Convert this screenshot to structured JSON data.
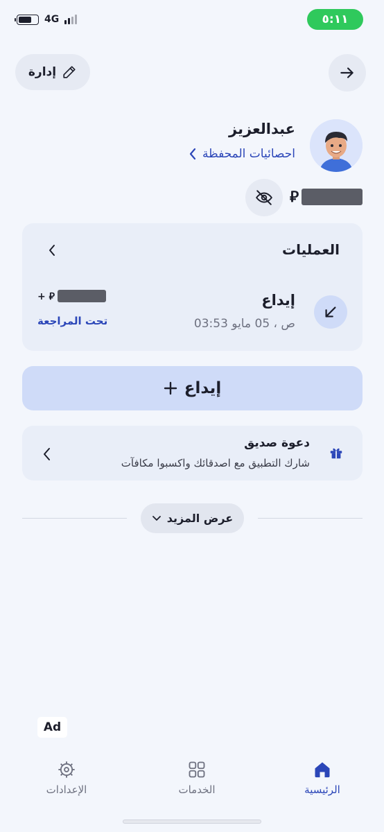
{
  "status_bar": {
    "time": "٥:١١",
    "network": "4G"
  },
  "header": {
    "manage_label": "إدارة"
  },
  "profile": {
    "name": "عبدالعزيز",
    "stats_link": "احصائيات المحفظة"
  },
  "balance": {
    "currency_symbol": "⃁"
  },
  "operations": {
    "title": "العمليات",
    "transactions": [
      {
        "title": "إيداع",
        "datetime": "03:53 ص ، 05 مايو",
        "amount_prefix": "+ ⃁",
        "status": "تحت المراجعة"
      }
    ]
  },
  "deposit_button": {
    "label": "إيداع",
    "icon": "plus-icon"
  },
  "invite": {
    "title": "دعوة صديق",
    "subtitle": "شارك التطبيق مع اصدقائك واكسبوا مكافآت"
  },
  "show_more": {
    "label": "عرض المزيد"
  },
  "ad": {
    "label": "Ad"
  },
  "bottom_nav": {
    "items": [
      {
        "label": "الرئيسية",
        "icon": "home-icon",
        "active": true
      },
      {
        "label": "الخدمات",
        "icon": "grid-icon",
        "active": false
      },
      {
        "label": "الإعدادات",
        "icon": "gear-icon",
        "active": false
      }
    ]
  },
  "colors": {
    "background": "#f3f6fc",
    "accent": "#2b46b8",
    "status_green": "#2fc95c",
    "card": "#e9eef8",
    "primary_button": "#cfdbf8"
  }
}
